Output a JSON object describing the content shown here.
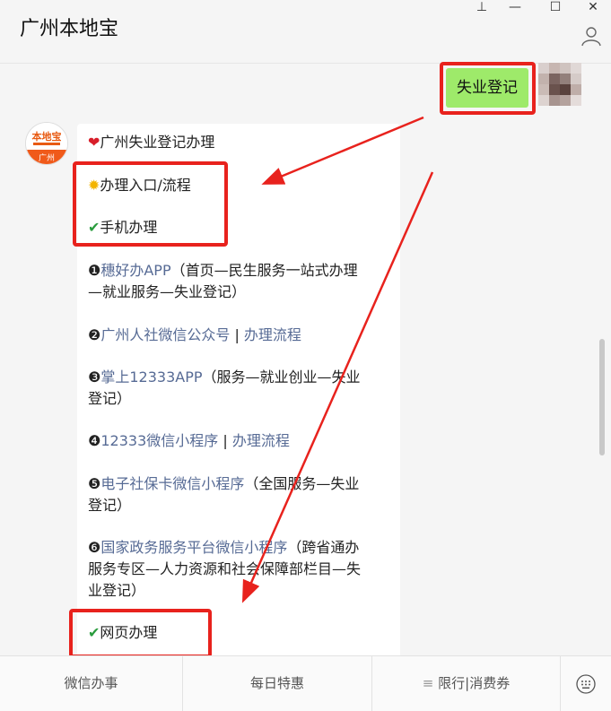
{
  "window": {
    "title": "广州本地宝",
    "controls": [
      "⊥",
      "—",
      "☐",
      "✕"
    ]
  },
  "chat": {
    "my_message": "失业登记",
    "reply": {
      "heading": "广州失业登记办理",
      "section1": "办理入口/流程",
      "subsection_mobile": "手机办理",
      "items": [
        {
          "num": "❶",
          "link": "穗好办APP",
          "note_line1": "（首页—民生服务一站式办理",
          "note_line2": "—就业服务—失业登记）"
        },
        {
          "num": "❷",
          "link": "广州人社微信公众号",
          "sep": " | ",
          "link2": "办理流程"
        },
        {
          "num": "❸",
          "link": "掌上12333APP",
          "note_line1": "（服务—就业创业—失业",
          "note_line2": "登记）"
        },
        {
          "num": "❹",
          "link": "12333微信小程序",
          "sep": " | ",
          "link2": "办理流程"
        },
        {
          "num": "❺",
          "link": "电子社保卡微信小程序",
          "note_line1": "（全国服务—失业",
          "note_line2": "登记）"
        },
        {
          "num": "❻",
          "link": "国家政务服务平台微信小程序",
          "note_line1": "（跨省通办",
          "note_line2": "服务专区—人力资源和社会保障部栏目—失",
          "note_line3": "业登记）"
        }
      ],
      "subsection_web": "网页办理"
    },
    "avatar_logo": "本地宝",
    "avatar_sub": "广州"
  },
  "bottom_menu": {
    "item1": "微信办事",
    "item2": "每日特惠",
    "item3": "限行|消费券"
  },
  "colors": {
    "highlight_box": "#e8221d",
    "link": "#576b95",
    "my_bubble": "#9eea6a"
  }
}
